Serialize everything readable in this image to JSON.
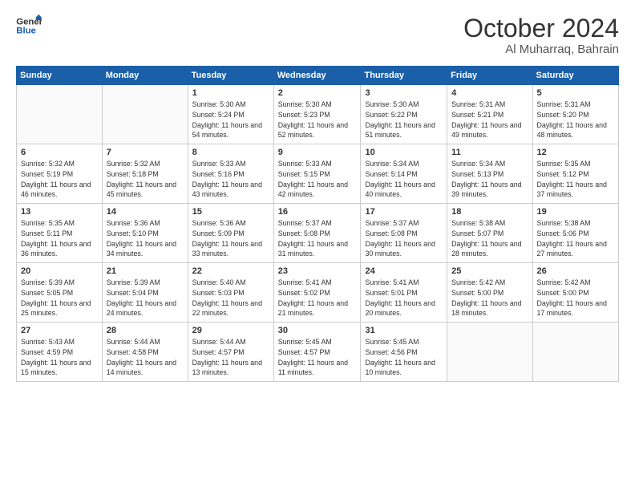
{
  "header": {
    "logo_line1": "General",
    "logo_line2": "Blue",
    "month": "October 2024",
    "location": "Al Muharraq, Bahrain"
  },
  "weekdays": [
    "Sunday",
    "Monday",
    "Tuesday",
    "Wednesday",
    "Thursday",
    "Friday",
    "Saturday"
  ],
  "weeks": [
    [
      {
        "day": "",
        "sunrise": "",
        "sunset": "",
        "daylight": ""
      },
      {
        "day": "",
        "sunrise": "",
        "sunset": "",
        "daylight": ""
      },
      {
        "day": "1",
        "sunrise": "Sunrise: 5:30 AM",
        "sunset": "Sunset: 5:24 PM",
        "daylight": "Daylight: 11 hours and 54 minutes."
      },
      {
        "day": "2",
        "sunrise": "Sunrise: 5:30 AM",
        "sunset": "Sunset: 5:23 PM",
        "daylight": "Daylight: 11 hours and 52 minutes."
      },
      {
        "day": "3",
        "sunrise": "Sunrise: 5:30 AM",
        "sunset": "Sunset: 5:22 PM",
        "daylight": "Daylight: 11 hours and 51 minutes."
      },
      {
        "day": "4",
        "sunrise": "Sunrise: 5:31 AM",
        "sunset": "Sunset: 5:21 PM",
        "daylight": "Daylight: 11 hours and 49 minutes."
      },
      {
        "day": "5",
        "sunrise": "Sunrise: 5:31 AM",
        "sunset": "Sunset: 5:20 PM",
        "daylight": "Daylight: 11 hours and 48 minutes."
      }
    ],
    [
      {
        "day": "6",
        "sunrise": "Sunrise: 5:32 AM",
        "sunset": "Sunset: 5:19 PM",
        "daylight": "Daylight: 11 hours and 46 minutes."
      },
      {
        "day": "7",
        "sunrise": "Sunrise: 5:32 AM",
        "sunset": "Sunset: 5:18 PM",
        "daylight": "Daylight: 11 hours and 45 minutes."
      },
      {
        "day": "8",
        "sunrise": "Sunrise: 5:33 AM",
        "sunset": "Sunset: 5:16 PM",
        "daylight": "Daylight: 11 hours and 43 minutes."
      },
      {
        "day": "9",
        "sunrise": "Sunrise: 5:33 AM",
        "sunset": "Sunset: 5:15 PM",
        "daylight": "Daylight: 11 hours and 42 minutes."
      },
      {
        "day": "10",
        "sunrise": "Sunrise: 5:34 AM",
        "sunset": "Sunset: 5:14 PM",
        "daylight": "Daylight: 11 hours and 40 minutes."
      },
      {
        "day": "11",
        "sunrise": "Sunrise: 5:34 AM",
        "sunset": "Sunset: 5:13 PM",
        "daylight": "Daylight: 11 hours and 39 minutes."
      },
      {
        "day": "12",
        "sunrise": "Sunrise: 5:35 AM",
        "sunset": "Sunset: 5:12 PM",
        "daylight": "Daylight: 11 hours and 37 minutes."
      }
    ],
    [
      {
        "day": "13",
        "sunrise": "Sunrise: 5:35 AM",
        "sunset": "Sunset: 5:11 PM",
        "daylight": "Daylight: 11 hours and 36 minutes."
      },
      {
        "day": "14",
        "sunrise": "Sunrise: 5:36 AM",
        "sunset": "Sunset: 5:10 PM",
        "daylight": "Daylight: 11 hours and 34 minutes."
      },
      {
        "day": "15",
        "sunrise": "Sunrise: 5:36 AM",
        "sunset": "Sunset: 5:09 PM",
        "daylight": "Daylight: 11 hours and 33 minutes."
      },
      {
        "day": "16",
        "sunrise": "Sunrise: 5:37 AM",
        "sunset": "Sunset: 5:08 PM",
        "daylight": "Daylight: 11 hours and 31 minutes."
      },
      {
        "day": "17",
        "sunrise": "Sunrise: 5:37 AM",
        "sunset": "Sunset: 5:08 PM",
        "daylight": "Daylight: 11 hours and 30 minutes."
      },
      {
        "day": "18",
        "sunrise": "Sunrise: 5:38 AM",
        "sunset": "Sunset: 5:07 PM",
        "daylight": "Daylight: 11 hours and 28 minutes."
      },
      {
        "day": "19",
        "sunrise": "Sunrise: 5:38 AM",
        "sunset": "Sunset: 5:06 PM",
        "daylight": "Daylight: 11 hours and 27 minutes."
      }
    ],
    [
      {
        "day": "20",
        "sunrise": "Sunrise: 5:39 AM",
        "sunset": "Sunset: 5:05 PM",
        "daylight": "Daylight: 11 hours and 25 minutes."
      },
      {
        "day": "21",
        "sunrise": "Sunrise: 5:39 AM",
        "sunset": "Sunset: 5:04 PM",
        "daylight": "Daylight: 11 hours and 24 minutes."
      },
      {
        "day": "22",
        "sunrise": "Sunrise: 5:40 AM",
        "sunset": "Sunset: 5:03 PM",
        "daylight": "Daylight: 11 hours and 22 minutes."
      },
      {
        "day": "23",
        "sunrise": "Sunrise: 5:41 AM",
        "sunset": "Sunset: 5:02 PM",
        "daylight": "Daylight: 11 hours and 21 minutes."
      },
      {
        "day": "24",
        "sunrise": "Sunrise: 5:41 AM",
        "sunset": "Sunset: 5:01 PM",
        "daylight": "Daylight: 11 hours and 20 minutes."
      },
      {
        "day": "25",
        "sunrise": "Sunrise: 5:42 AM",
        "sunset": "Sunset: 5:00 PM",
        "daylight": "Daylight: 11 hours and 18 minutes."
      },
      {
        "day": "26",
        "sunrise": "Sunrise: 5:42 AM",
        "sunset": "Sunset: 5:00 PM",
        "daylight": "Daylight: 11 hours and 17 minutes."
      }
    ],
    [
      {
        "day": "27",
        "sunrise": "Sunrise: 5:43 AM",
        "sunset": "Sunset: 4:59 PM",
        "daylight": "Daylight: 11 hours and 15 minutes."
      },
      {
        "day": "28",
        "sunrise": "Sunrise: 5:44 AM",
        "sunset": "Sunset: 4:58 PM",
        "daylight": "Daylight: 11 hours and 14 minutes."
      },
      {
        "day": "29",
        "sunrise": "Sunrise: 5:44 AM",
        "sunset": "Sunset: 4:57 PM",
        "daylight": "Daylight: 11 hours and 13 minutes."
      },
      {
        "day": "30",
        "sunrise": "Sunrise: 5:45 AM",
        "sunset": "Sunset: 4:57 PM",
        "daylight": "Daylight: 11 hours and 11 minutes."
      },
      {
        "day": "31",
        "sunrise": "Sunrise: 5:45 AM",
        "sunset": "Sunset: 4:56 PM",
        "daylight": "Daylight: 11 hours and 10 minutes."
      },
      {
        "day": "",
        "sunrise": "",
        "sunset": "",
        "daylight": ""
      },
      {
        "day": "",
        "sunrise": "",
        "sunset": "",
        "daylight": ""
      }
    ]
  ]
}
